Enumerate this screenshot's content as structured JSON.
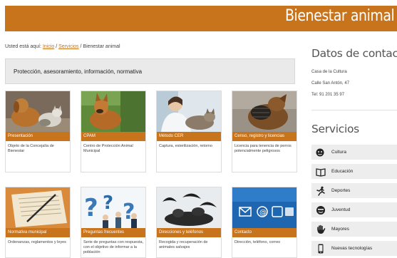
{
  "header": {
    "title": "Bienestar animal"
  },
  "breadcrumb": {
    "prefix": "Usted está aquí:",
    "home": "Inicio",
    "sep1": "/",
    "services": "Servicios",
    "sep2": "/",
    "current": "Bienestar animal"
  },
  "intro": {
    "text": "Protección, asesoramiento, información, normativa"
  },
  "cards": [
    {
      "title": "Presentación",
      "desc": "Objeto de la Concejalía de Bienestar"
    },
    {
      "title": "CPAM",
      "desc": "Centro de Protección Animal Municipal"
    },
    {
      "title": "Método CER",
      "desc": "Captura, esterilización, retorno"
    },
    {
      "title": "Censo, registro y licencias",
      "desc": "Licencia para tenencia de perros potencialmente peligrosos"
    },
    {
      "title": "Normativa municipal",
      "desc": "Ordenanzas, reglamentos y leyes"
    },
    {
      "title": "Preguntas frecuentes",
      "desc": "Serie de preguntas con respuesta, con el objetivo de informar a la población"
    },
    {
      "title": "Direcciones y teléfonos",
      "desc": "Recogida y recuperación de animales salvajes"
    },
    {
      "title": "Contacto",
      "desc": "Dirección, teléfono, correo"
    }
  ],
  "contact": {
    "heading": "Datos de contacto",
    "place": "Casa de la Cultura",
    "street": "Calle San Antón, 47",
    "phone": "Tel: 91 201 35 97"
  },
  "services": {
    "heading": "Servicios",
    "items": [
      {
        "label": "Cultura",
        "icon": "theater-masks-icon"
      },
      {
        "label": "Educación",
        "icon": "open-book-icon"
      },
      {
        "label": "Deportes",
        "icon": "running-person-icon"
      },
      {
        "label": "Juventud",
        "icon": "smiley-face-icon"
      },
      {
        "label": "Mayores",
        "icon": "hand-icon"
      },
      {
        "label": "Nuevas tecnologías",
        "icon": "smartphone-icon"
      }
    ]
  },
  "colors": {
    "accent": "#c8741c",
    "panel_gray": "#eaeaea",
    "link": "#c8741c"
  }
}
